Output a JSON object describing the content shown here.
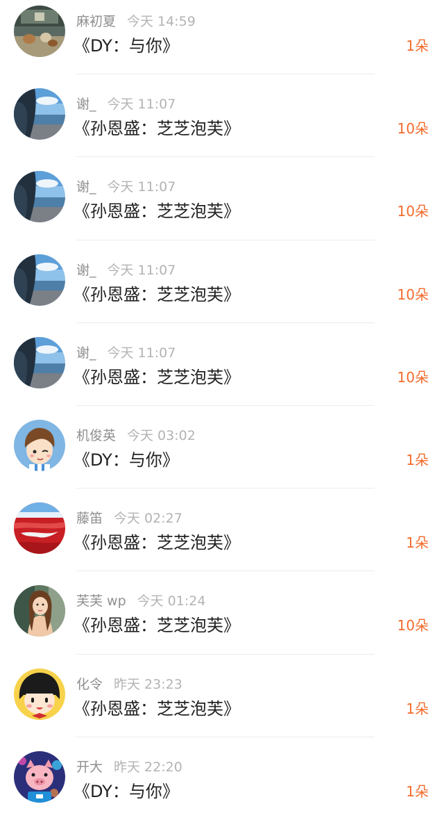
{
  "feed": {
    "items": [
      {
        "name": "麻初夏",
        "time": "今天 14:59",
        "title": "《DY：与你》",
        "count": "1朵",
        "avatar": "dogs-photo-avatar"
      },
      {
        "name": "谢_",
        "time": "今天 11:07",
        "title": "《孙恩盛：芝芝泡芙》",
        "count": "10朵",
        "avatar": "seaside-photo-avatar"
      },
      {
        "name": "谢_",
        "time": "今天 11:07",
        "title": "《孙恩盛：芝芝泡芙》",
        "count": "10朵",
        "avatar": "seaside-photo-avatar"
      },
      {
        "name": "谢_",
        "time": "今天 11:07",
        "title": "《孙恩盛：芝芝泡芙》",
        "count": "10朵",
        "avatar": "seaside-photo-avatar"
      },
      {
        "name": "谢_",
        "time": "今天 11:07",
        "title": "《孙恩盛：芝芝泡芙》",
        "count": "10朵",
        "avatar": "seaside-photo-avatar"
      },
      {
        "name": "机俊英",
        "time": "今天 03:02",
        "title": "《DY：与你》",
        "count": "1朵",
        "avatar": "cartoon-boy-avatar"
      },
      {
        "name": "藤笛",
        "time": "今天 02:27",
        "title": "《孙恩盛：芝芝泡芙》",
        "count": "1朵",
        "avatar": "red-beach-avatar"
      },
      {
        "name": "芙芙 wp",
        "time": "今天 01:24",
        "title": "《孙恩盛：芝芝泡芙》",
        "count": "10朵",
        "avatar": "girl-photo-avatar"
      },
      {
        "name": "化令",
        "time": "昨天 23:23",
        "title": "《孙恩盛：芝芝泡芙》",
        "count": "1朵",
        "avatar": "cartoon-girl-avatar"
      },
      {
        "name": "开大",
        "time": "昨天 22:20",
        "title": "《DY：与你》",
        "count": "1朵",
        "avatar": "cartoon-pig-avatar"
      }
    ]
  },
  "colors": {
    "accent": "#f26b2c",
    "title": "#222222",
    "meta": "#9a9a9a",
    "divider": "#ececec"
  }
}
